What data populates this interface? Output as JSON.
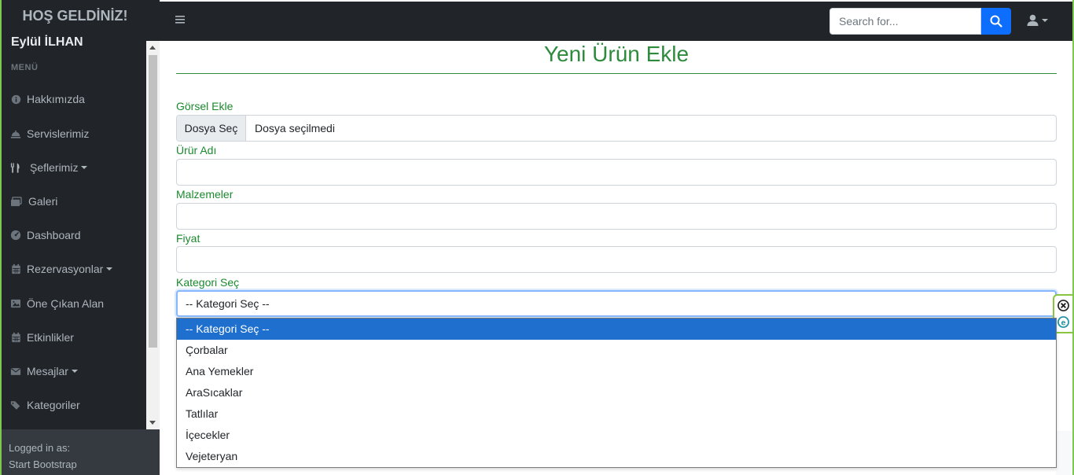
{
  "sidebar": {
    "brand": "HOŞ GELDİNİZ!",
    "user_name": "Eylül İLHAN",
    "menu_heading": "MENÜ",
    "items": [
      {
        "label": "Hakkımızda",
        "icon": "info-circle-icon",
        "dropdown": false
      },
      {
        "label": "Servislerimiz",
        "icon": "cloche-icon",
        "dropdown": false
      },
      {
        "label": "Şeflerimiz",
        "icon": "utensils-icon",
        "dropdown": true
      },
      {
        "label": "Galeri",
        "icon": "images-icon",
        "dropdown": false
      },
      {
        "label": "Dashboard",
        "icon": "gauge-icon",
        "dropdown": false
      },
      {
        "label": "Rezervasyonlar",
        "icon": "calendar-icon",
        "dropdown": true
      },
      {
        "label": "Öne Çıkan Alan",
        "icon": "image-icon",
        "dropdown": false
      },
      {
        "label": "Etkinlikler",
        "icon": "calendar-icon",
        "dropdown": false
      },
      {
        "label": "Mesajlar",
        "icon": "envelope-icon",
        "dropdown": true
      },
      {
        "label": "Kategoriler",
        "icon": "tags-icon",
        "dropdown": false
      }
    ],
    "footer": {
      "line1": "Logged in as:",
      "line2": "Start Bootstrap"
    }
  },
  "topbar": {
    "search_placeholder": "Search for...",
    "search_icon": "search-icon",
    "user_icon": "user-icon"
  },
  "form": {
    "title": "Yeni Ürün Ekle",
    "image_label": "Görsel Ekle",
    "file_button": "Dosya Seç",
    "file_status": "Dosya seçilmedi",
    "name_label": "Ürür Adı",
    "name_value": "",
    "ingredients_label": "Malzemeler",
    "ingredients_value": "",
    "price_label": "Fiyat",
    "price_value": "",
    "category_label": "Kategori Seç",
    "category_selected": "-- Kategori Seç --",
    "category_options": [
      "-- Kategori Seç --",
      "Çorbalar",
      "Ana Yemekler",
      "AraSıcaklar",
      "Tatlılar",
      "İçecekler",
      "Vejeteryan"
    ]
  },
  "colors": {
    "accent_green": "#2e8b3d",
    "primary_blue": "#0d6efd",
    "selected_option": "#1e6fce",
    "sidebar_bg": "#212529"
  }
}
